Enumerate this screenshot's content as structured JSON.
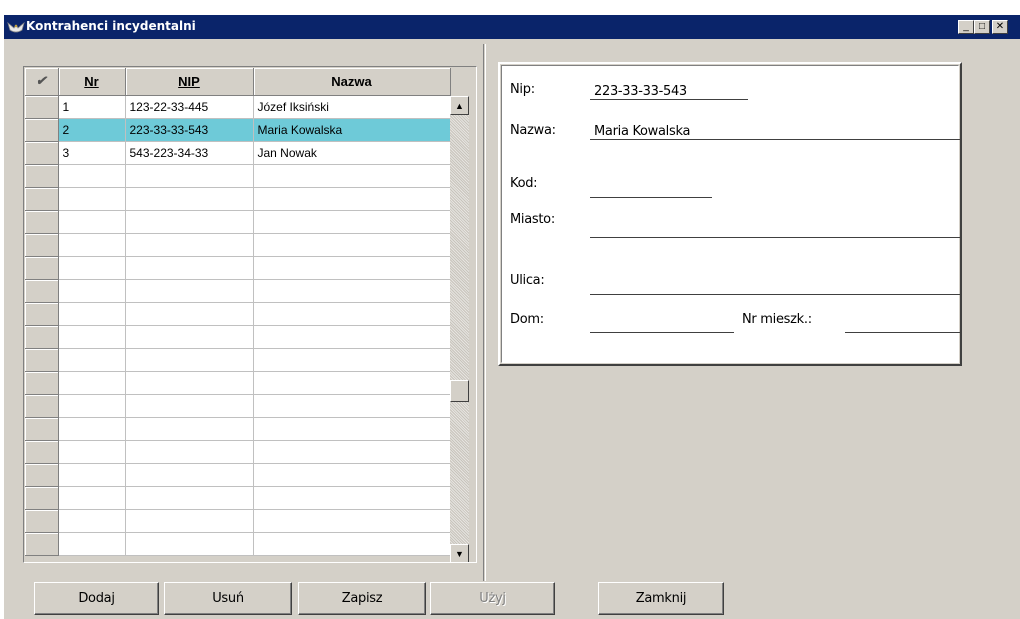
{
  "window": {
    "title": "Kontrahenci incydentalni",
    "minimize_glyph": "_",
    "maximize_glyph": "□",
    "close_glyph": "✕"
  },
  "grid": {
    "check_header_icon": "checkmark-icon",
    "check_header_glyph": "✔",
    "columns": {
      "nr": "Nr",
      "nip": "NIP",
      "nazwa": "Nazwa"
    },
    "rows": [
      {
        "nr": "1",
        "nip": "123-22-33-445",
        "nazwa": "Józef Iksiński",
        "selected": false
      },
      {
        "nr": "2",
        "nip": "223-33-33-543",
        "nazwa": "Maria Kowalska",
        "selected": true
      },
      {
        "nr": "3",
        "nip": "543-223-34-33",
        "nazwa": "Jan Nowak",
        "selected": false
      }
    ],
    "scroll_up_glyph": "▲",
    "scroll_down_glyph": "▼"
  },
  "details": {
    "nip_label": "Nip:",
    "nip_value": "223-33-33-543",
    "nazwa_label": "Nazwa:",
    "nazwa_value": "Maria Kowalska",
    "kod_label": "Kod:",
    "kod_value": "",
    "miasto_label": "Miasto:",
    "miasto_value": "",
    "ulica_label": "Ulica:",
    "ulica_value": "",
    "dom_label": "Dom:",
    "dom_value": "",
    "nr_mieszk_label": "Nr mieszk.:",
    "nr_mieszk_value": ""
  },
  "buttons": {
    "dodaj": "Dodaj",
    "usun": "Usuń",
    "zapisz": "Zapisz",
    "uzyj": "Użyj",
    "zamknij": "Zamknij"
  },
  "colors": {
    "titlebar": "#0a246a",
    "selection": "#6ecad8",
    "face": "#d4d0c8"
  }
}
